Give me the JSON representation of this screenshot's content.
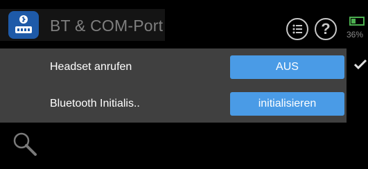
{
  "header": {
    "title": "BT & COM-Port",
    "app_icon": "bluetooth-com-port-icon",
    "menu_icon": "list-menu-icon",
    "help_icon": "help-icon",
    "help_glyph": "?",
    "battery": {
      "percent_label": "36%",
      "level": 0.36
    }
  },
  "settings": {
    "rows": [
      {
        "label": "Headset anrufen",
        "button": "AUS",
        "checked": true
      },
      {
        "label": "Bluetooth Initialis..",
        "button": "initialisieren"
      }
    ]
  },
  "footer": {
    "search_icon": "search-icon"
  },
  "colors": {
    "accent": "#4a9be6",
    "panel": "#404040",
    "background": "#000000",
    "battery": "#4caf50"
  }
}
